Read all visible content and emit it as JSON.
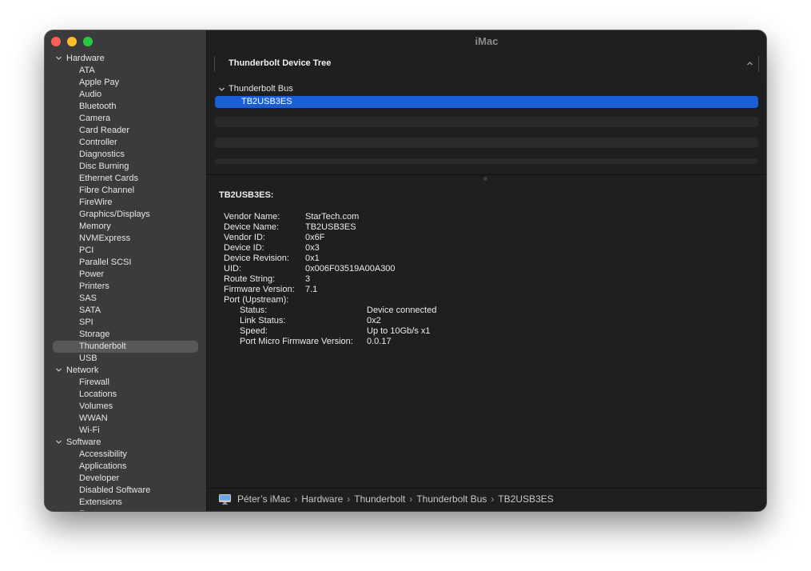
{
  "window": {
    "title": "iMac"
  },
  "sidebar": {
    "groups": [
      {
        "label": "Hardware",
        "items": [
          "ATA",
          "Apple Pay",
          "Audio",
          "Bluetooth",
          "Camera",
          "Card Reader",
          "Controller",
          "Diagnostics",
          "Disc Burning",
          "Ethernet Cards",
          "Fibre Channel",
          "FireWire",
          "Graphics/Displays",
          "Memory",
          "NVMExpress",
          "PCI",
          "Parallel SCSI",
          "Power",
          "Printers",
          "SAS",
          "SATA",
          "SPI",
          "Storage",
          "Thunderbolt",
          "USB"
        ]
      },
      {
        "label": "Network",
        "items": [
          "Firewall",
          "Locations",
          "Volumes",
          "WWAN",
          "Wi-Fi"
        ]
      },
      {
        "label": "Software",
        "items": [
          "Accessibility",
          "Applications",
          "Developer",
          "Disabled Software",
          "Extensions",
          "Fonts"
        ]
      }
    ],
    "selected_item": "Thunderbolt"
  },
  "device_tree": {
    "header": "Thunderbolt Device Tree",
    "bus_label": "Thunderbolt Bus",
    "selected_device": "TB2USB3ES"
  },
  "details": {
    "title": "TB2USB3ES:",
    "properties": [
      {
        "key": "Vendor Name:",
        "value": "StarTech.com"
      },
      {
        "key": "Device Name:",
        "value": "TB2USB3ES"
      },
      {
        "key": "Vendor ID:",
        "value": "0x6F"
      },
      {
        "key": "Device ID:",
        "value": "0x3"
      },
      {
        "key": "Device Revision:",
        "value": "0x1"
      },
      {
        "key": "UID:",
        "value": "0x006F03519A00A300"
      },
      {
        "key": "Route String:",
        "value": "3"
      },
      {
        "key": "Firmware Version:",
        "value": "7.1"
      },
      {
        "key": "Port (Upstream):",
        "value": ""
      }
    ],
    "port_properties": [
      {
        "key": "Status:",
        "value": "Device connected"
      },
      {
        "key": "Link Status:",
        "value": "0x2"
      },
      {
        "key": "Speed:",
        "value": "Up to 10Gb/s x1"
      },
      {
        "key": "Port Micro Firmware Version:",
        "value": "0.0.17"
      }
    ]
  },
  "breadcrumb": [
    "Péter’s iMac",
    "Hardware",
    "Thunderbolt",
    "Thunderbolt Bus",
    "TB2USB3ES"
  ],
  "icons": {
    "computer": "imac-icon",
    "expand": "chevron-down-icon",
    "collapse": "chevron-up-icon"
  }
}
